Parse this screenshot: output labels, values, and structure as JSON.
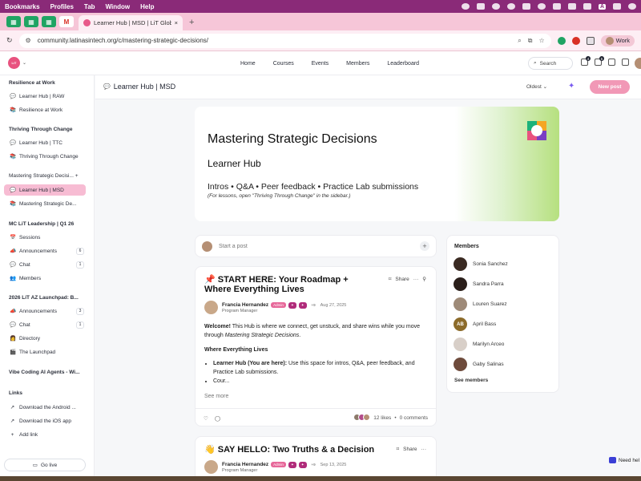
{
  "menubar": {
    "items": [
      "Bookmarks",
      "Profiles",
      "Tab",
      "Window",
      "Help"
    ],
    "right_key": "A"
  },
  "browser": {
    "tab_title": "Learner Hub | MSD | LiT Glob",
    "url": "community.latinasintech.org/c/mastering-strategic-decisions/",
    "profile": "Work",
    "new_tab": "+",
    "close_tab": "×"
  },
  "header": {
    "nav": [
      "Home",
      "Courses",
      "Events",
      "Members",
      "Leaderboard"
    ],
    "search_placeholder": "Search",
    "badges": {
      "notifications": "4",
      "messages": "5"
    }
  },
  "sidebar": {
    "groups": [
      {
        "title": "Resilience at Work",
        "items": [
          {
            "icon": "💬",
            "label": "Learner Hub | RAW"
          },
          {
            "icon": "📚",
            "label": "Resilience at Work"
          }
        ]
      },
      {
        "title": "Thriving Through Change",
        "items": [
          {
            "icon": "💬",
            "label": "Learner Hub | TTC"
          },
          {
            "icon": "📚",
            "label": "Thriving Through Change"
          }
        ]
      },
      {
        "title": "Mastering Strategic Decisi...",
        "add": "+",
        "items": [
          {
            "icon": "💬",
            "label": "Learner Hub | MSD",
            "active": true
          },
          {
            "icon": "📚",
            "label": "Mastering Strategic De..."
          }
        ]
      },
      {
        "title": "MC LiT Leadership | Q1 26",
        "items": [
          {
            "icon": "📅",
            "label": "Sessions"
          },
          {
            "icon": "📣",
            "label": "Announcements",
            "count": "6"
          },
          {
            "icon": "💬",
            "label": "Chat",
            "count": "1"
          },
          {
            "icon": "👥",
            "label": "Members"
          }
        ]
      },
      {
        "title": "2026 LiT AZ Launchpad: B...",
        "items": [
          {
            "icon": "📣",
            "label": "Announcements",
            "count": "3"
          },
          {
            "icon": "💬",
            "label": "Chat",
            "count": "1"
          },
          {
            "icon": "👩",
            "label": "Directory"
          },
          {
            "icon": "🎬",
            "label": "The Launchpad"
          }
        ]
      },
      {
        "title": "Vibe Coding AI Agents - Wi...",
        "items": []
      },
      {
        "title": "Links",
        "items": [
          {
            "icon": "↗",
            "label": "Download the Android ..."
          },
          {
            "icon": "↗",
            "label": "Download the iOS app"
          },
          {
            "icon": "+",
            "label": "Add link"
          }
        ]
      }
    ],
    "go_live": "Go live"
  },
  "page": {
    "title": "Learner Hub | MSD",
    "sort": "Oldest",
    "new_post": "New post"
  },
  "banner": {
    "title": "Mastering Strategic Decisions",
    "subtitle": "Learner Hub",
    "tagline": "Intros • Q&A • Peer feedback • Practice Lab submissions",
    "note": "(For lessons, open \"Thriving Through Change\" in the sidebar.)"
  },
  "start_post": {
    "placeholder": "Start a post"
  },
  "posts": [
    {
      "emoji": "📌",
      "title": "START HERE: Your Roadmap + Where Everything Lives",
      "share": "Share",
      "author": "Francia Hernandez",
      "role": "Program Manager",
      "tag": "Admin",
      "tag_extra": "+9",
      "date": "Aug 27, 2025",
      "welcome_bold": "Welcome!",
      "welcome_text": " This Hub is where we connect, get unstuck, and share wins while you move through ",
      "welcome_italic": "Mastering Strategic Decisions",
      "welcome_end": ".",
      "section_heading": "Where Everything Lives",
      "bullet1_bold": "Learner Hub (You are here):",
      "bullet1_text": " Use this space for intros, Q&A, peer feedback, and Practice Lab submissions.",
      "bullet2": "Cour...",
      "see_more": "See more",
      "likes": "12 likes",
      "comments": "0 comments"
    },
    {
      "emoji": "👋",
      "title": "SAY HELLO: Two Truths & a Decision",
      "share": "Share",
      "author": "Francia Hernandez",
      "role": "Program Manager",
      "tag": "Admin",
      "tag_extra": "+9",
      "date": "Sep 13, 2025"
    }
  ],
  "members": {
    "heading": "Members",
    "list": [
      {
        "name": "Sonia Sanchez",
        "color": "#3a2a22"
      },
      {
        "name": "Sandra Parra",
        "color": "#2b1f1b"
      },
      {
        "name": "Louren Suarez",
        "color": "#9e8a78"
      },
      {
        "name": "April Bass",
        "initials": "AB",
        "color": "#8c6b2a"
      },
      {
        "name": "Marilyn Arceo",
        "color": "#d8cfc8"
      },
      {
        "name": "Gaby Salinas",
        "color": "#6e4b3c"
      }
    ],
    "see_all": "See members"
  },
  "help": {
    "label": "Need hel"
  }
}
